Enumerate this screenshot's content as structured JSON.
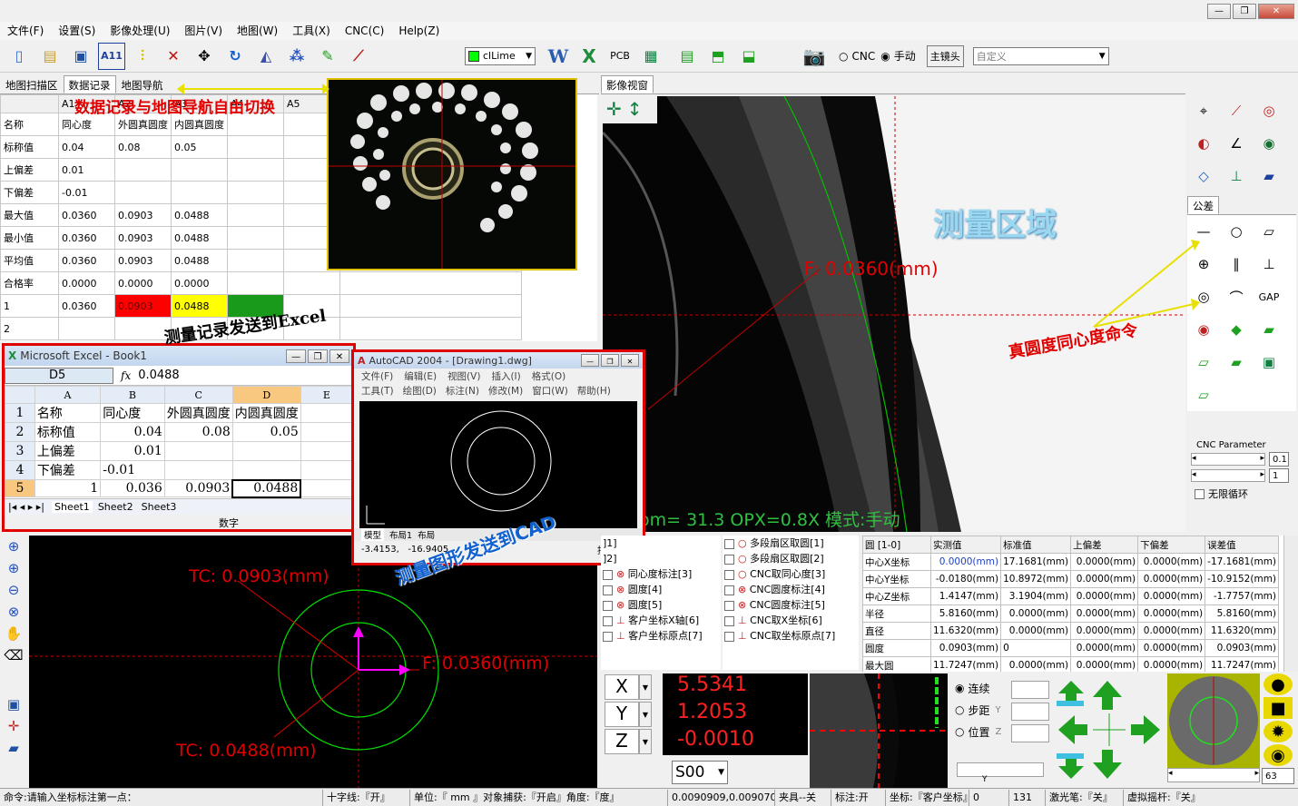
{
  "menu": [
    "文件(F)",
    "设置(S)",
    "影像处理(U)",
    "图片(V)",
    "地图(W)",
    "工具(X)",
    "CNC(C)",
    "Help(Z)"
  ],
  "toolbar": {
    "color_select": "clLime",
    "cnc_label": "CNC",
    "manual_label": "手动",
    "main_lens": "主镜头",
    "custom": "自定义",
    "pcb": "PCB",
    "a11": "A11"
  },
  "left_tabs": [
    "地图扫描区",
    "数据记录",
    "地图导航"
  ],
  "view_tab": "影像视窗",
  "annotations": {
    "switch": "数据记录与地图导航自由切换",
    "excel": "测量记录发送到Excel",
    "cad": "测量图形发送到CAD",
    "area": "测量区域",
    "cmd": "真圆度同心度命令"
  },
  "grid": {
    "cols": [
      "A1",
      "A2",
      "A3",
      "A4",
      "A5"
    ],
    "rows": [
      [
        "名称",
        "同心度",
        "外圆真圆度",
        "内圆真圆度",
        ""
      ],
      [
        "标称值",
        "0.04",
        "0.08",
        "0.05",
        ""
      ],
      [
        "上偏差",
        "0.01",
        "",
        "",
        ""
      ],
      [
        "下偏差",
        "-0.01",
        "",
        "",
        ""
      ],
      [
        "最大值",
        "0.0360",
        "0.0903",
        "0.0488",
        ""
      ],
      [
        "最小值",
        "0.0360",
        "0.0903",
        "0.0488",
        ""
      ],
      [
        "平均值",
        "0.0360",
        "0.0903",
        "0.0488",
        ""
      ],
      [
        "合格率",
        "0.0000",
        "0.0000",
        "0.0000",
        ""
      ],
      [
        "1",
        "0.0360",
        "0.0903",
        "0.0488",
        ""
      ],
      [
        "2",
        "",
        "",
        "",
        ""
      ]
    ]
  },
  "main_view": {
    "measure": "F:  0.0360(mm)",
    "status_line": "om=  31.3  OPX=0.8X  模式:手动"
  },
  "right_panel": {
    "tab": "公差",
    "cnc_param": "CNC Parameter",
    "val1": "0.1",
    "val2": "1",
    "loop": "无限循环",
    "gap": "GAP"
  },
  "excel": {
    "title": "Microsoft Excel - Book1",
    "cell": "D5",
    "formula": "0.0488",
    "cols": [
      "",
      "A",
      "B",
      "C",
      "D",
      "E"
    ],
    "rows": [
      [
        "1",
        "名称",
        "同心度",
        "外圆真圆度",
        "内圆真圆度",
        ""
      ],
      [
        "2",
        "标称值",
        "0.04",
        "0.08",
        "0.05",
        ""
      ],
      [
        "3",
        "上偏差",
        "0.01",
        "",
        "",
        ""
      ],
      [
        "4",
        "下偏差",
        "-0.01",
        "",
        "",
        ""
      ],
      [
        "5",
        "1",
        "0.036",
        "0.0903",
        "0.0488",
        ""
      ]
    ],
    "sheets": [
      "Sheet1",
      "Sheet2",
      "Sheet3"
    ],
    "status": "数字"
  },
  "cad": {
    "title": "AutoCAD 2004 - [Drawing1.dwg]",
    "menu1": [
      "文件(F)",
      "编辑(E)",
      "视图(V)",
      "插入(I)",
      "格式(O)"
    ],
    "menu2": [
      "工具(T)",
      "绘图(D)",
      "标注(N)",
      "修改(M)",
      "窗口(W)",
      "帮助(H)"
    ],
    "tabs": [
      "模型",
      "布局1",
      "布局"
    ],
    "coords": "-3.4153,   -16.9405",
    "snap": "捕捉"
  },
  "bottom_view": {
    "tc1": "TC:  0.0903(mm)",
    "tc2": "TC:  0.0488(mm)",
    "f": "F:  0.0360(mm)"
  },
  "checklist1": [
    "]1]",
    "]2]",
    "同心度标注[3]",
    "圆度[4]",
    "圆度[5]",
    "客户坐标X轴[6]",
    "客户坐标原点[7]"
  ],
  "checklist2": [
    "多段扇区取圆[1]",
    "多段扇区取圆[2]",
    "CNC取同心度[3]",
    "CNC圆度标注[4]",
    "CNC圆度标注[5]",
    "CNC取X坐标[6]",
    "CNC取坐标原点[7]"
  ],
  "results": {
    "header": [
      "圆 [1-0]",
      "实测值",
      "标准值",
      "上偏差",
      "下偏差",
      "误差值"
    ],
    "rows": [
      [
        "中心X坐标",
        "0.0000(mm)",
        "17.1681(mm)",
        "0.0000(mm)",
        "0.0000(mm)",
        "-17.1681(mm)"
      ],
      [
        "中心Y坐标",
        "-0.0180(mm)",
        "10.8972(mm)",
        "0.0000(mm)",
        "0.0000(mm)",
        "-10.9152(mm)"
      ],
      [
        "中心Z坐标",
        "1.4147(mm)",
        "3.1904(mm)",
        "0.0000(mm)",
        "0.0000(mm)",
        "-1.7757(mm)"
      ],
      [
        "半径",
        "5.8160(mm)",
        "0.0000(mm)",
        "0.0000(mm)",
        "0.0000(mm)",
        "5.8160(mm)"
      ],
      [
        "直径",
        "11.6320(mm)",
        "0.0000(mm)",
        "0.0000(mm)",
        "0.0000(mm)",
        "11.6320(mm)"
      ],
      [
        "圆度",
        "0.0903(mm)",
        "0",
        "0.0000(mm)",
        "0.0000(mm)",
        "0.0903(mm)"
      ],
      [
        "最大圆",
        "11.7247(mm)",
        "0.0000(mm)",
        "0.0000(mm)",
        "0.0000(mm)",
        "11.7247(mm)"
      ]
    ]
  },
  "dro": {
    "x_label": "X",
    "y_label": "Y",
    "z_label": "Z",
    "x": "5.5341",
    "y": "1.2053",
    "z": "-0.0010",
    "s_select": "S00"
  },
  "move": {
    "continuous": "连续",
    "step": "步距",
    "position": "位置",
    "y": "Y",
    "z": "Z",
    "yb": "Y"
  },
  "zoom_val": "63",
  "status": [
    "命令:请输入坐标标注第一点：",
    "十字线:『开』",
    "单位:『 mm 』对象捕获:『开启』角度:『度』",
    "0.0090909,0.009070",
    "夹具--关",
    "标注:开",
    "坐标:『客户坐标』",
    "0",
    "131",
    "激光笔:『关』",
    "虚拟摇杆:『关』"
  ]
}
